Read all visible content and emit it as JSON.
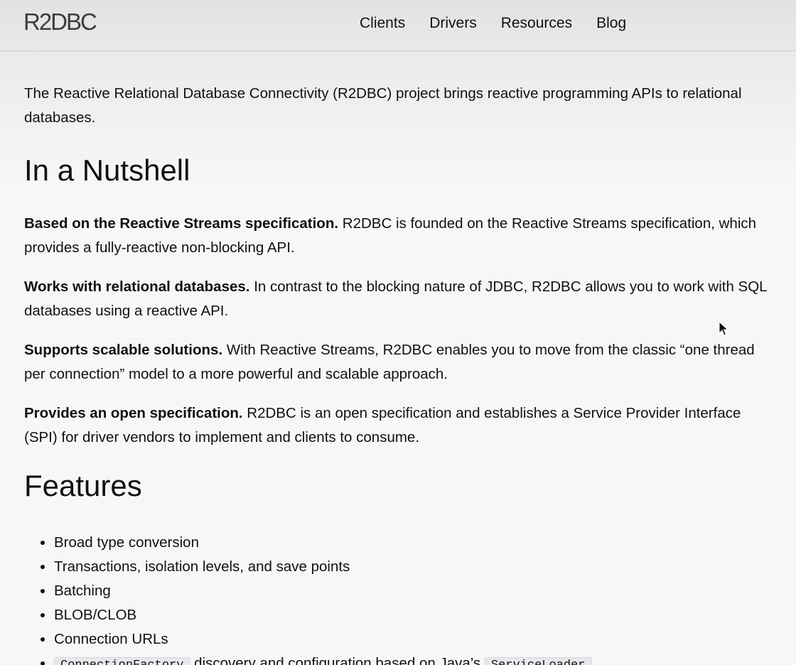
{
  "header": {
    "logo": "R2DBC",
    "nav": [
      "Clients",
      "Drivers",
      "Resources",
      "Blog"
    ]
  },
  "intro": "The Reactive Relational Database Connectivity (R2DBC) project brings reactive programming APIs to relational databases.",
  "nutshell": {
    "heading": "In a Nutshell",
    "items": [
      {
        "title": "Based on the Reactive Streams specification.",
        "text": "R2DBC is founded on the Reactive Streams specification, which provides a fully-reactive non-blocking API."
      },
      {
        "title": "Works with relational databases.",
        "text": "In contrast to the blocking nature of JDBC, R2DBC allows you to work with SQL databases using a reactive API."
      },
      {
        "title": "Supports scalable solutions.",
        "text": "With Reactive Streams, R2DBC enables you to move from the classic “one thread per connection” model to a more powerful and scalable approach."
      },
      {
        "title": "Provides an open specification.",
        "text": "R2DBC is an open specification and establishes a Service Provider Interface (SPI) for driver vendors to implement and clients to consume."
      }
    ]
  },
  "features": {
    "heading": "Features",
    "items": [
      "Broad type conversion",
      "Transactions, isolation levels, and save points",
      "Batching",
      "BLOB/CLOB",
      "Connection URLs"
    ],
    "last_item": {
      "code1": "ConnectionFactory",
      "text": "discovery and configuration based on Java’s",
      "code2": "ServiceLoader"
    }
  }
}
